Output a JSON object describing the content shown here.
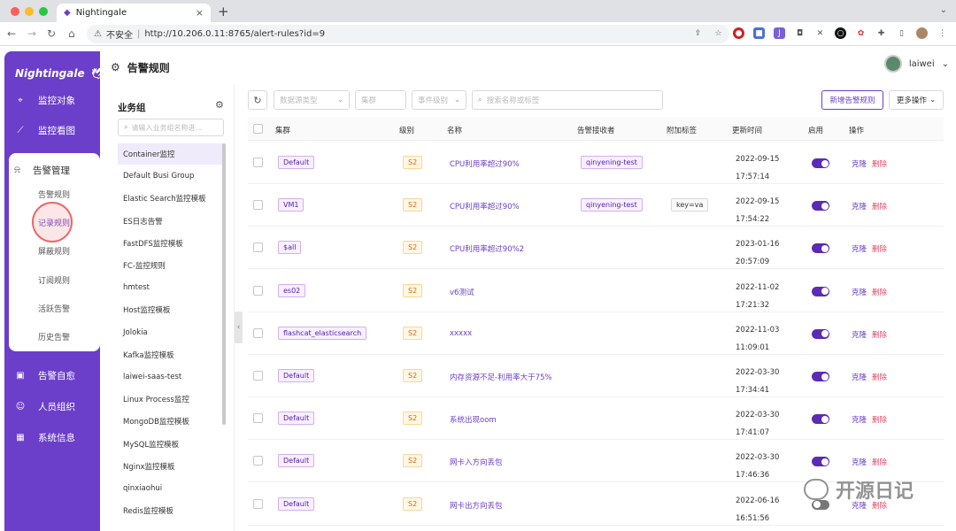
{
  "browser": {
    "tab_title": "Nightingale",
    "tab_close": "×",
    "new_tab": "+",
    "security_label": "不安全",
    "separator": "|",
    "url": "http://10.206.0.11:8765/alert-rules?id=9"
  },
  "sidebar": {
    "logo": "Nightingale",
    "items": [
      {
        "label": "监控对象",
        "icon": "target-icon"
      },
      {
        "label": "监控看图",
        "icon": "chart-icon"
      },
      {
        "label": "告警管理",
        "icon": "bell-icon"
      },
      {
        "label": "告警自愈",
        "icon": "terminal-icon"
      },
      {
        "label": "人员组织",
        "icon": "user-icon"
      },
      {
        "label": "系统信息",
        "icon": "grid-icon"
      }
    ],
    "sub_items": [
      "告警规则",
      "记录规则",
      "屏蔽规则",
      "订阅规则",
      "活跃告警",
      "历史告警"
    ],
    "active_sub": "记录规则"
  },
  "header": {
    "title": "告警规则",
    "username": "laiwei"
  },
  "groups": {
    "title": "业务组",
    "search_placeholder": "请输入业务组名称进...",
    "items": [
      "Container监控",
      "Default Busi Group",
      "Elastic Search监控模板",
      "ES日志告警",
      "FastDFS监控模板",
      "FC-监控规则",
      "hmtest",
      "Host监控模板",
      "Jolokia",
      "Kafka监控模板",
      "laiwei-saas-test",
      "Linux Process监控",
      "MongoDB监控模板",
      "MySQL监控模板",
      "Nginx监控模板",
      "qinxiaohui",
      "Redis监控模板"
    ]
  },
  "toolbar": {
    "datasource_placeholder": "数据源类型",
    "cluster_placeholder": "集群",
    "severity_placeholder": "事件级别",
    "search_placeholder": "搜索名称或标签",
    "new_button": "新增告警规则",
    "more_button": "更多操作"
  },
  "table": {
    "headers": [
      "集群",
      "级别",
      "名称",
      "告警接收者",
      "附加标签",
      "更新时间",
      "启用",
      "操作"
    ],
    "clone_label": "克隆",
    "delete_label": "删除",
    "rows": [
      {
        "cluster": "Default",
        "severity": "S2",
        "name": "CPU利用率超过90%",
        "receiver": "qinyening-test",
        "tag": "",
        "date": "2022-09-15",
        "time": "17:57:14",
        "enabled": true
      },
      {
        "cluster": "VM1",
        "severity": "S2",
        "name": "CPU利用率超过90%",
        "receiver": "qinyening-test",
        "tag": "key=va",
        "date": "2022-09-15",
        "time": "17:54:22",
        "enabled": true
      },
      {
        "cluster": "$all",
        "severity": "S2",
        "name": "CPU利用率超过90%2",
        "receiver": "",
        "tag": "",
        "date": "2023-01-16",
        "time": "20:57:09",
        "enabled": true
      },
      {
        "cluster": "es02",
        "severity": "S2",
        "name": "v6测试",
        "receiver": "",
        "tag": "",
        "date": "2022-11-02",
        "time": "17:21:32",
        "enabled": true
      },
      {
        "cluster": "flashcat_elasticsearch",
        "severity": "S2",
        "name": "xxxxx",
        "receiver": "",
        "tag": "",
        "date": "2022-11-03",
        "time": "11:09:01",
        "enabled": true
      },
      {
        "cluster": "Default",
        "severity": "S2",
        "name": "内存资源不足-利用率大于75%",
        "receiver": "",
        "tag": "",
        "date": "2022-03-30",
        "time": "17:34:41",
        "enabled": true
      },
      {
        "cluster": "Default",
        "severity": "S2",
        "name": "系统出现oom",
        "receiver": "",
        "tag": "",
        "date": "2022-03-30",
        "time": "17:41:07",
        "enabled": true
      },
      {
        "cluster": "Default",
        "severity": "S2",
        "name": "网卡入方向丢包",
        "receiver": "",
        "tag": "",
        "date": "2022-03-30",
        "time": "17:46:36",
        "enabled": true
      },
      {
        "cluster": "Default",
        "severity": "S2",
        "name": "网卡出方向丢包",
        "receiver": "",
        "tag": "",
        "date": "2022-06-16",
        "time": "16:51:56",
        "enabled": false
      }
    ]
  },
  "watermark": "开源日记",
  "colors": {
    "accent": "#6b3fc9",
    "danger": "#e04a6a",
    "severity": "#d46b08"
  }
}
